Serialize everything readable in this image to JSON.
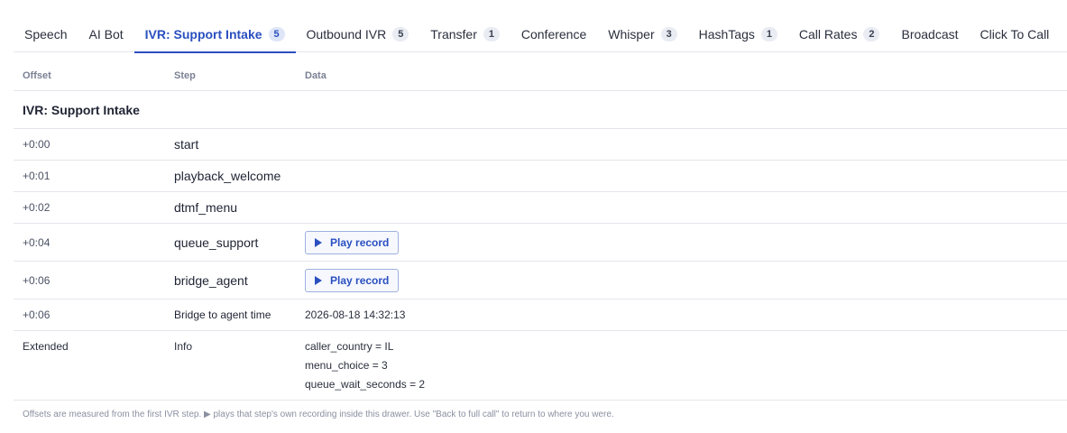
{
  "tabs": [
    {
      "label": "Speech",
      "count": null
    },
    {
      "label": "AI Bot",
      "count": null
    },
    {
      "label": "IVR: Support Intake",
      "count": "5"
    },
    {
      "label": "Outbound IVR",
      "count": "5"
    },
    {
      "label": "Transfer",
      "count": "1"
    },
    {
      "label": "Conference",
      "count": null
    },
    {
      "label": "Whisper",
      "count": "3"
    },
    {
      "label": "HashTags",
      "count": "1"
    },
    {
      "label": "Call Rates",
      "count": "2"
    },
    {
      "label": "Broadcast",
      "count": null
    },
    {
      "label": "Click To Call",
      "count": null
    }
  ],
  "active_tab": "IVR: Support Intake",
  "table": {
    "headers": {
      "offset": "Offset",
      "step": "Step",
      "data": "Data"
    },
    "section_title": "IVR: Support Intake",
    "rows": [
      {
        "offset": "+0:00",
        "step": "start",
        "data": ""
      },
      {
        "offset": "+0:01",
        "step": "playback_welcome",
        "data": ""
      },
      {
        "offset": "+0:02",
        "step": "dtmf_menu",
        "data": ""
      },
      {
        "offset": "+0:04",
        "step": "queue_support",
        "button": "Play record"
      },
      {
        "offset": "+0:06",
        "step": "bridge_agent",
        "button": "Play record"
      },
      {
        "offset": "+0:06",
        "step": "Bridge to agent time",
        "data": "2026-08-18 14:32:13"
      }
    ],
    "extended": {
      "offset": "Extended",
      "step": "Info",
      "lines": [
        "caller_country = IL",
        "menu_choice = 3",
        "queue_wait_seconds = 2"
      ]
    }
  },
  "footer_note": "Offsets are measured from the first IVR step. ▶ plays that step's own recording inside this drawer. Use \"Back to full call\" to return to where you were.",
  "colors": {
    "accent": "#2a4fbf",
    "border": "#e3e6ec",
    "muted": "#7a8194"
  }
}
